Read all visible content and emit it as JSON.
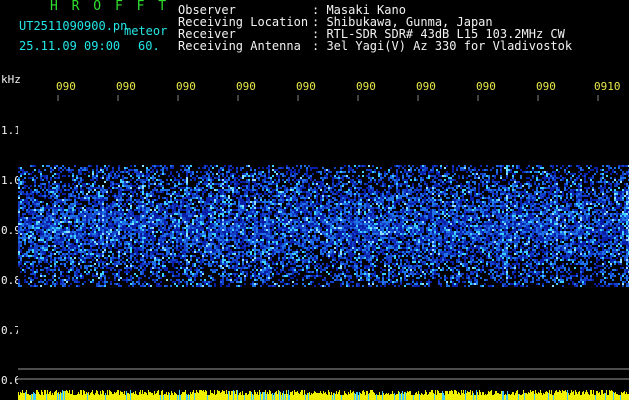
{
  "header": {
    "app_logo": "H R O F F T",
    "file_name": "UT2511090900.pn",
    "file_suffix": "meteor",
    "date_time": "25.11.09 09:00",
    "interval": "60.",
    "fields": [
      {
        "label": "Observer",
        "value": ": Masaki Kano"
      },
      {
        "label": "Receiving Location",
        "value": ": Shibukawa, Gunma, Japan"
      },
      {
        "label": "Receiver",
        "value": ": RTL-SDR SDR# 43dB L15 103.2MHz CW"
      },
      {
        "label": "Receiving Antenna",
        "value": ": 3el Yagi(V) Az 330 for Vladivostok"
      }
    ]
  },
  "axis": {
    "unit": "kHz",
    "time_ticks": [
      "090",
      "090",
      "090",
      "090",
      "090",
      "090",
      "090",
      "090",
      "090",
      "0910"
    ],
    "freq_ticks": [
      "1.1",
      "1.0",
      "0.9",
      "0.8",
      "0.7",
      "0.6"
    ]
  },
  "colors": {
    "background": "#000000",
    "logo": "#2fe02f",
    "meta": "#23e6e6",
    "labels": "#f2f2f2",
    "time_ticks": "#e8e84a",
    "signal_low": "#0a1fa8",
    "signal_high": "#3ccfff",
    "bottom_bar": "#f0f000"
  }
}
